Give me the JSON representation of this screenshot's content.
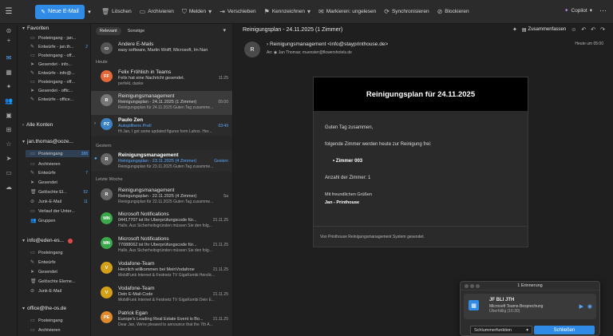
{
  "toolbar": {
    "new_mail": "Neue E-Mail",
    "delete": "Löschen",
    "archive": "Archivieren",
    "report": "Melden",
    "move": "Verschieben",
    "flag": "Kennzeichnen",
    "mark_unread": "Markieren: ungelesen",
    "sync": "Synchronisieren",
    "block": "Blockieren",
    "copilot": "Copilot"
  },
  "folders": {
    "favorites": {
      "title": "Favoriten",
      "items": [
        {
          "label": "Posteingang - jan...",
          "count": ""
        },
        {
          "label": "Entwürfe - jan.th...",
          "count": "2"
        },
        {
          "label": "Posteingang - off...",
          "count": ""
        },
        {
          "label": "Gesendet - info...",
          "count": ""
        },
        {
          "label": "Entwürfe - info@...",
          "count": ""
        },
        {
          "label": "Posteingang - off...",
          "count": ""
        },
        {
          "label": "Gesendet - offic...",
          "count": ""
        },
        {
          "label": "Entwürfe - office...",
          "count": ""
        }
      ]
    },
    "all_accounts": "Alle Konten",
    "account1": {
      "title": "jan.thomas@ooze...",
      "items": [
        {
          "label": "Posteingang",
          "count": "388"
        },
        {
          "label": "Archivieren",
          "count": ""
        },
        {
          "label": "Entwürfe",
          "count": "7"
        },
        {
          "label": "Gesendet",
          "count": ""
        },
        {
          "label": "Gelöschte El...",
          "count": "52"
        },
        {
          "label": "Junk-E-Mail",
          "count": "11"
        },
        {
          "label": "Verlauf der Unter...",
          "count": ""
        },
        {
          "label": "Gruppen",
          "count": ""
        }
      ]
    },
    "account2": {
      "title": "info@eden-es...",
      "items": [
        {
          "label": "Posteingang",
          "count": ""
        },
        {
          "label": "Entwürfe",
          "count": ""
        },
        {
          "label": "Gesendet",
          "count": ""
        },
        {
          "label": "Gelöschte Eleme...",
          "count": ""
        },
        {
          "label": "Junk-E-Mail",
          "count": ""
        }
      ]
    },
    "account3": {
      "title": "office@the-os.de",
      "items": [
        {
          "label": "Posteingang",
          "count": ""
        },
        {
          "label": "Archivieren",
          "count": ""
        }
      ]
    }
  },
  "list": {
    "tab_relevant": "Relevant",
    "tab_other": "Sonstige",
    "groups": {
      "today": "Heute",
      "yesterday": "Gestern",
      "last_week": "Letzte Woche"
    },
    "mails": [
      {
        "initials": "",
        "sender": "Andere E-Mails",
        "subject": "easy software, Martin Wolff, Microsoft, Im Namen ...",
        "preview": "",
        "time": ""
      },
      {
        "initials": "FF",
        "sender": "Felix Fröhlich in Teams",
        "subject": "Felix hat eine Nachricht gesendet.",
        "preview": "perfekt, danke",
        "time": "11:25"
      },
      {
        "initials": "R",
        "sender": "Reinigungsmanagement",
        "subject": "Reinigungsplan - 24.11.2025 (1 Zimmer)",
        "preview": "Reinigungsplan für 24.11.2025 Guten Tag zusamme...",
        "time": "05:00"
      },
      {
        "initials": "PZ",
        "sender": "Paulo Zen",
        "subject": "Autopilfrens Prell",
        "preview": "Hi Jan, I got some updated figures form Lahos. Her...",
        "time": "03:49"
      },
      {
        "initials": "R",
        "sender": "Reinigungsmanagement",
        "subject": "Reinigungsplan - 23.11.2025 (4 Zimmer)",
        "preview": "Reinigungsplan für 23.11.2025 Guten Tag zusamme...",
        "time": "Gestern"
      },
      {
        "initials": "R",
        "sender": "Reinigungsmanagement",
        "subject": "Reinigungsplan - 22.11.2025 (4 Zimmer)",
        "preview": "Reinigungsplan für 22.11.2025 Guten Tag zusamme...",
        "time": "Sa"
      },
      {
        "initials": "MN",
        "sender": "Microsoft Notifications",
        "subject": "04417707 ist Ihr Überprüfungscode für...",
        "preview": "Hallo, Aus Sicherheitsgründen müssen Sie den folg...",
        "time": "21.11.25"
      },
      {
        "initials": "MN",
        "sender": "Microsoft Notifications",
        "subject": "77088062 ist Ihr Überprüfungscode für...",
        "preview": "Hallo, Aus Sicherheitsgründen müssen Sie den folg...",
        "time": "21.11.25"
      },
      {
        "initials": "V",
        "sender": "Vodafone-Team",
        "subject": "Herzlich willkommen bei MeinVodafone",
        "preview": "MobilFunk Internet & Festnetz TV GigaKombi Herzlic...",
        "time": "21.11.25"
      },
      {
        "initials": "V",
        "sender": "Vodafone-Team",
        "subject": "Dein E-Mail-Code",
        "preview": "MobilFunk Internet & Festnetz TV GigaKombi Dein E...",
        "time": "21.11.25"
      },
      {
        "initials": "PE",
        "sender": "Patrick Egan",
        "subject": "Europe's Leading Real Estate Event is Bo...",
        "preview": "Dear Jan, We're pleased to announce that the 7th A...",
        "time": "21.11.25"
      }
    ]
  },
  "reader": {
    "title": "Reinigungsplan - 24.11.2025 (1 Zimmer)",
    "summarize": "Zusammenfassen",
    "avatar": "R",
    "from": "Reinigungsmanagement <info@stayprinthouse.de>",
    "to_label": "An:",
    "to": "Jan Thomas;  muenster@flowershotels.de",
    "date": "Heute um 05:00",
    "card": {
      "heading": "Reinigungsplan für 24.11.2025",
      "greeting": "Guten Tag zusammen,",
      "intro": "folgende Zimmer werden heute zur Reinigung frei:",
      "room": "Zimmer 003",
      "count": "Anzahl der Zimmer: 1",
      "sign1": "Mit freundlichen Grüßen",
      "sign2": "Jan - Printhouse",
      "footer": "Von Printhouse Reinigungsmanagement System gesendet."
    }
  },
  "reminder": {
    "header": "1 Erinnerung",
    "title": "JF BLI JTH",
    "type": "Microsoft Teams-Besprechung",
    "when": "Überfällig (16:30)",
    "snooze": "Schlummerfunktion",
    "close": "Schließen"
  }
}
